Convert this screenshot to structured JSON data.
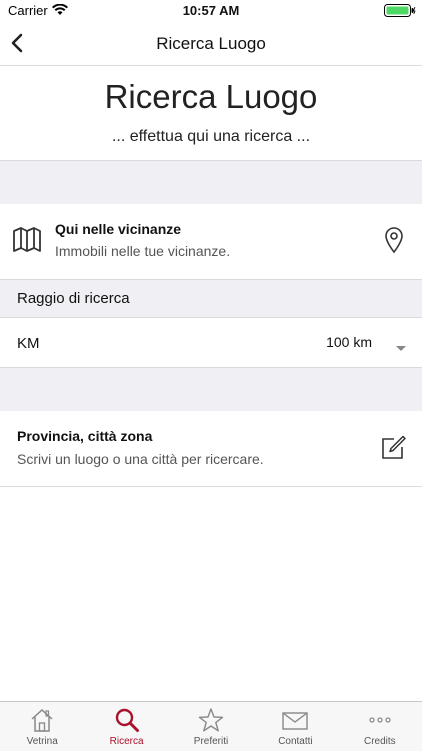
{
  "status_bar": {
    "carrier": "Carrier",
    "time": "10:57 AM"
  },
  "nav": {
    "title": "Ricerca Luogo"
  },
  "header": {
    "title": "Ricerca Luogo",
    "subtitle": "... effettua qui una ricerca ..."
  },
  "nearby": {
    "title": "Qui nelle vicinanze",
    "subtitle": "Immobili nelle tue vicinanze."
  },
  "radius": {
    "section_label": "Raggio di ricerca",
    "unit_label": "KM",
    "selected_value": "100 km"
  },
  "location": {
    "title": "Provincia, città zona",
    "subtitle": "Scrivi un luogo o una città per ricercare."
  },
  "tabs": [
    {
      "label": "Vetrina",
      "icon": "house-icon"
    },
    {
      "label": "Ricerca",
      "icon": "search-icon"
    },
    {
      "label": "Preferiti",
      "icon": "star-icon"
    },
    {
      "label": "Contatti",
      "icon": "envelope-icon"
    },
    {
      "label": "Credits",
      "icon": "ellipsis-icon"
    }
  ],
  "active_tab": "Ricerca",
  "colors": {
    "accent": "#a8102b",
    "battery": "#4cd964",
    "group_bg": "#efeff4"
  }
}
